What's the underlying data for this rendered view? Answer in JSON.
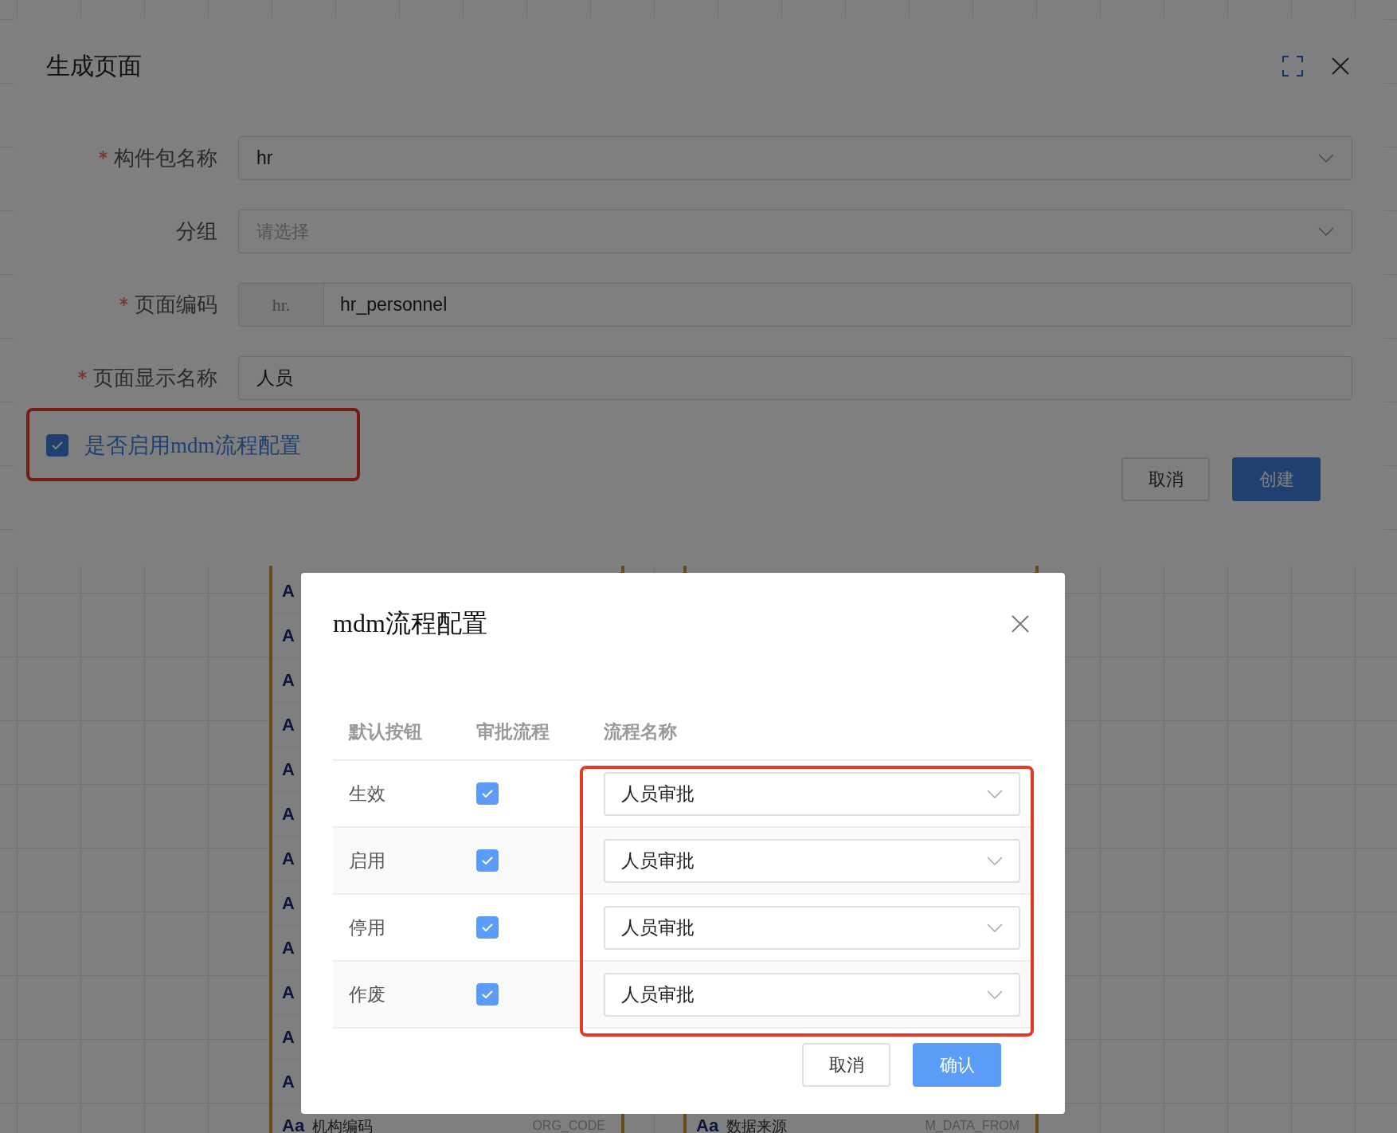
{
  "background": {
    "cards": [
      {
        "rows": [
          {
            "icon_text": "A"
          },
          {
            "icon_text": "A"
          },
          {
            "icon_text": "A"
          },
          {
            "icon_text": "A"
          },
          {
            "icon_text": "A"
          },
          {
            "icon_text": "A"
          },
          {
            "icon_text": "A"
          },
          {
            "icon_text": "A"
          },
          {
            "icon_text": "A"
          },
          {
            "icon_text": "A"
          },
          {
            "icon_text": "A"
          },
          {
            "icon_text": "A"
          },
          {
            "icon_text": "Aa",
            "label": "机构编码",
            "code": "ORG_CODE"
          }
        ]
      },
      {
        "rows": [
          {
            "icon_text": "Aa",
            "label": "数据来源",
            "code": "M_DATA_FROM"
          }
        ]
      }
    ]
  },
  "generate_dialog": {
    "title": "生成页面",
    "fields": [
      {
        "kind": "select",
        "label": "构件包名称",
        "required": true,
        "value": "hr"
      },
      {
        "kind": "select",
        "label": "分组",
        "required": false,
        "placeholder": "请选择"
      },
      {
        "kind": "prefixed",
        "label": "页面编码",
        "required": true,
        "prefix": "hr.",
        "value": "hr_personnel"
      },
      {
        "kind": "text",
        "label": "页面显示名称",
        "required": true,
        "value": "人员"
      }
    ],
    "mdm_toggle": {
      "label": "是否启用mdm流程配置",
      "checked": true
    },
    "buttons": [
      {
        "label": "取消",
        "kind": "default"
      },
      {
        "label": "创建",
        "kind": "primary"
      }
    ]
  },
  "mdm_dialog": {
    "title": "mdm流程配置",
    "columns": [
      "默认按钮",
      "审批流程",
      "流程名称"
    ],
    "rows": [
      {
        "button": "生效",
        "approval": true,
        "process": "人员审批"
      },
      {
        "button": "启用",
        "approval": true,
        "process": "人员审批"
      },
      {
        "button": "停用",
        "approval": true,
        "process": "人员审批"
      },
      {
        "button": "作废",
        "approval": true,
        "process": "人员审批"
      }
    ],
    "buttons": [
      {
        "label": "取消",
        "kind": "default"
      },
      {
        "label": "确认",
        "kind": "primary"
      }
    ]
  }
}
